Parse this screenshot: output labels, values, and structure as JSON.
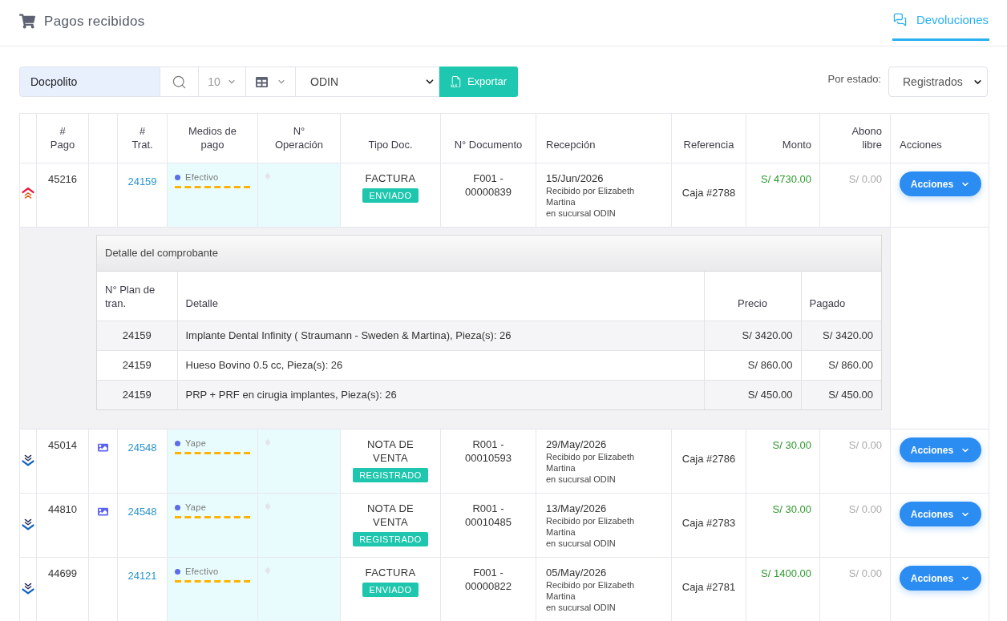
{
  "header": {
    "title": "Pagos recibidos",
    "tabs": [
      {
        "label": "Devoluciones",
        "selected": true
      }
    ]
  },
  "toolbar": {
    "search": {
      "value": "Docpolito"
    },
    "page_size": "10",
    "branch": "ODIN",
    "export_button": "Exportar",
    "status_filter": {
      "label": "Por estado:",
      "value": "Registrados"
    }
  },
  "table": {
    "columns": [
      "#\nPago",
      "#\nTrat.",
      "Medios de\npago",
      "N°\nOperación",
      "Tipo Doc.",
      "N° Documento",
      "Recepción",
      "Referencia",
      "Monto",
      "Abono\nlibre",
      "Acciones"
    ],
    "rows": [
      {
        "expanded": true,
        "attachment": false,
        "payment_id": "45216",
        "treatment": "24159",
        "payment_method": "Efectivo",
        "doc_type": "FACTURA",
        "status": "ENVIADO",
        "document": "F001 - 00000839",
        "date": "15/Jun/2026",
        "received_by": "Recibido por Elizabeth Martina",
        "branch": "en sucursal ODIN",
        "reference": "Caja #2788",
        "amount": "S/ 4730.00",
        "free_payment": "S/ 0.00",
        "actions": "Acciones",
        "detail": {
          "title": "Detalle del comprobante",
          "columns": [
            "N° Plan de\ntran.",
            "Detalle",
            "Precio",
            "Pagado"
          ],
          "rows": [
            {
              "plan": "24159",
              "detail": "Implante Dental Infinity ( Straumann - Sweden & Martina), Pieza(s): 26",
              "price": "S/ 3420.00",
              "paid": "S/ 3420.00"
            },
            {
              "plan": "24159",
              "detail": "Hueso Bovino 0.5 cc, Pieza(s): 26",
              "price": "S/ 860.00",
              "paid": "S/ 860.00"
            },
            {
              "plan": "24159",
              "detail": "PRP + PRF en cirugia implantes, Pieza(s): 26",
              "price": "S/ 450.00",
              "paid": "S/ 450.00"
            }
          ]
        }
      },
      {
        "expanded": false,
        "attachment": true,
        "payment_id": "45014",
        "treatment": "24548",
        "payment_method": "Yape",
        "doc_type": "NOTA DE VENTA",
        "status": "REGISTRADO",
        "document": "R001 - 00010593",
        "date": "29/May/2026",
        "received_by": "Recibido por Elizabeth Martina",
        "branch": "en sucursal ODIN",
        "reference": "Caja #2786",
        "amount": "S/ 30.00",
        "free_payment": "S/ 0.00",
        "actions": "Acciones"
      },
      {
        "expanded": false,
        "attachment": true,
        "payment_id": "44810",
        "treatment": "24548",
        "payment_method": "Yape",
        "doc_type": "NOTA DE VENTA",
        "status": "REGISTRADO",
        "document": "R001 - 00010485",
        "date": "13/May/2026",
        "received_by": "Recibido por Elizabeth Martina",
        "branch": "en sucursal ODIN",
        "reference": "Caja #2783",
        "amount": "S/ 30.00",
        "free_payment": "S/ 0.00",
        "actions": "Acciones"
      },
      {
        "expanded": false,
        "attachment": false,
        "payment_id": "44699",
        "treatment": "24121",
        "payment_method": "Efectivo",
        "doc_type": "FACTURA",
        "status": "ENVIADO",
        "document": "F001 - 00000822",
        "date": "05/May/2026",
        "received_by": "Recibido por Elizabeth Martina",
        "branch": "en sucursal ODIN",
        "reference": "Caja #2781",
        "amount": "S/ 1400.00",
        "free_payment": "S/ 0.00",
        "actions": "Acciones"
      }
    ]
  }
}
